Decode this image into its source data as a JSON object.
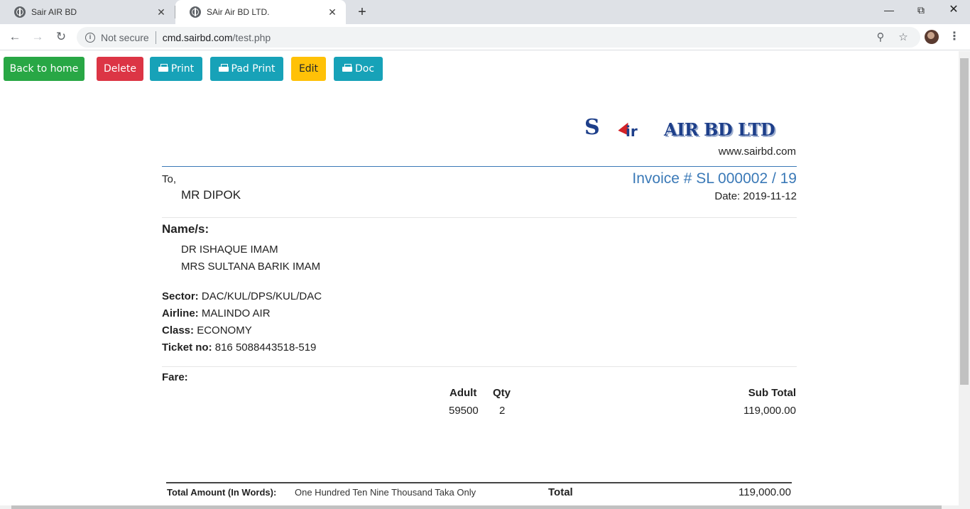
{
  "browser": {
    "tabs": [
      {
        "title": "Sair AIR BD",
        "active": false
      },
      {
        "title": "SAir Air BD LTD.",
        "active": true
      }
    ],
    "security": "Not secure",
    "url_host": "cmd.sairbd.com",
    "url_path": "/test.php"
  },
  "actions": {
    "back": "Back to home",
    "delete": "Delete",
    "print": "Print",
    "pad_print": "Pad Print",
    "edit": "Edit",
    "doc": "Doc"
  },
  "brand": {
    "logo_s": "S",
    "logo_air": "ir",
    "logo_text": "AIR BD LTD",
    "website": "www.sairbd.com",
    "colors": {
      "primary": "#1e3f8a",
      "accent": "#d42227",
      "invoice_blue": "#3a79b7"
    }
  },
  "invoice": {
    "to_label": "To,",
    "client": "MR DIPOK",
    "number": "Invoice # SL 000002 / 19",
    "date": "Date: 2019-11-12",
    "names_title": "Name/s:",
    "names": [
      "DR ISHAQUE IMAM",
      "MRS SULTANA BARIK IMAM"
    ],
    "sector_label": "Sector:",
    "sector": "DAC/KUL/DPS/KUL/DAC",
    "airline_label": "Airline:",
    "airline": "MALINDO AIR",
    "class_label": "Class:",
    "class": "ECONOMY",
    "ticket_label": "Ticket no:",
    "ticket": "816 5088443518-519",
    "fare_title": "Fare:",
    "fare_headers": {
      "adult": "Adult",
      "qty": "Qty",
      "subtotal": "Sub Total"
    },
    "fare_row": {
      "adult": "59500",
      "qty": "2",
      "subtotal": "119,000.00"
    },
    "words_label": "Total Amount (In Words):",
    "words": "One Hundred Ten Nine Thousand Taka Only",
    "total_label": "Total",
    "total": "119,000.00"
  }
}
